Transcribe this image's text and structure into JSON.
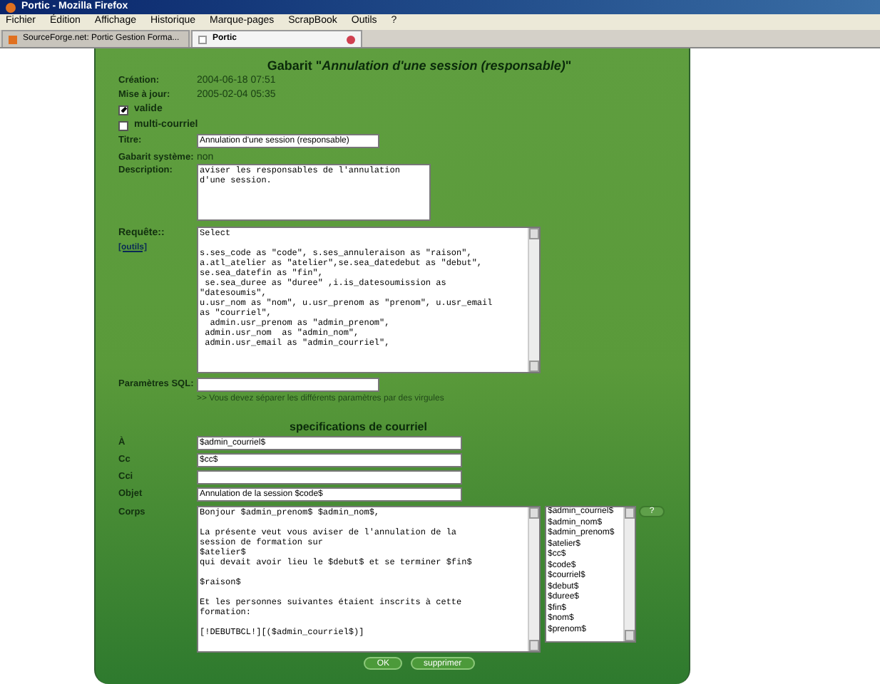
{
  "window": {
    "title": "Portic - Mozilla Firefox"
  },
  "menu": [
    "Fichier",
    "Édition",
    "Affichage",
    "Historique",
    "Marque-pages",
    "ScrapBook",
    "Outils",
    "?"
  ],
  "tabs": [
    {
      "label": "SourceForge.net: Portic Gestion Forma...",
      "selected": false
    },
    {
      "label": "Portic",
      "selected": true
    }
  ],
  "heading": "Gabarit \"*Annulation d'une session (responsable)*\"",
  "info": [
    {
      "label": "Création:",
      "value": "2004-06-18 07:51"
    },
    {
      "label": "Mise à jour:",
      "value": "2005-02-04 05:35"
    }
  ],
  "checkboxes": [
    {
      "label": "valide",
      "checked": true
    },
    {
      "label": "multi-courriel",
      "checked": false
    }
  ],
  "titre": {
    "label": "Titre:",
    "value": "Annulation d'une session (responsable)"
  },
  "systeme": {
    "label": "Gabarit système:",
    "value": "non"
  },
  "description": {
    "label": "Description:",
    "value": "aviser les responsables de l'annulation\nd'une session."
  },
  "requete": {
    "label": "Requête::",
    "link": "[outils]",
    "value": "Select\n\ns.ses_code as \"code\", s.ses_annuleraison as \"raison\",\na.atl_atelier as \"atelier\",se.sea_datedebut as \"debut\",\nse.sea_datefin as \"fin\",\n se.sea_duree as \"duree\" ,i.is_datesoumission as\n\"datesoumis\",\nu.usr_nom as \"nom\", u.usr_prenom as \"prenom\", u.usr_email\nas \"courriel\",\n  admin.usr_prenom as \"admin_prenom\",\n admin.usr_nom  as \"admin_nom\",\n admin.usr_email as \"admin_courriel\","
  },
  "sql": {
    "label": "Paramètres SQL:",
    "hint": ">> Vous devez séparer les différents paramètres par des virgules"
  },
  "email": {
    "heading": "specifications de courriel",
    "fields": [
      {
        "label": "À",
        "value": "$admin_courriel$"
      },
      {
        "label": "Cc",
        "value": "$cc$"
      },
      {
        "label": "Cci"
      },
      {
        "label": "Objet",
        "value": "Annulation de la session $code$"
      }
    ],
    "corps": {
      "label": "Corps",
      "value": "Bonjour $admin_prenom$ $admin_nom$,\n\nLa présente veut vous aviser de l'annulation de la\nsession de formation sur\n$atelier$\nqui devait avoir lieu le $debut$ et se terminer $fin$\n\n$raison$\n\nEt les personnes suivantes étaient inscrits à cette\nformation:\n\n[!DEBUTBCL!][($admin_courriel$)]"
    },
    "variables": [
      "$admin_courriel$",
      "$admin_nom$",
      "$admin_prenom$",
      "$atelier$",
      "$cc$",
      "$code$",
      "$courriel$",
      "$debut$",
      "$duree$",
      "$fin$",
      "$nom$",
      "$prenom$"
    ],
    "help": "?"
  },
  "buttons": [
    "OK",
    "supprimer"
  ]
}
